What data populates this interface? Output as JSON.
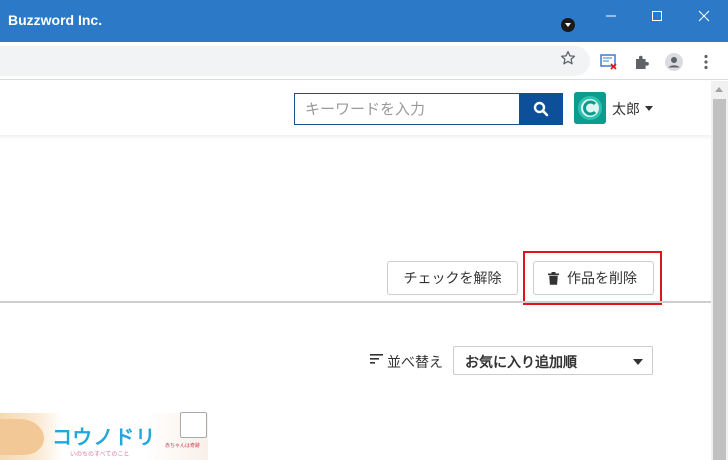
{
  "window": {
    "title": "Buzzword Inc."
  },
  "header": {
    "search": {
      "placeholder": "キーワードを入力"
    },
    "user": {
      "name": "太郎"
    }
  },
  "actions": {
    "uncheck_label": "チェックを解除",
    "delete_label": "作品を削除"
  },
  "sort": {
    "label": "並べ替え",
    "selected": "お気に入り追加順"
  },
  "card": {
    "logo": "コウノドリ",
    "sub": "いのちのすべてのこと",
    "note": "赤ちゃんは奇跡"
  },
  "colors": {
    "titlebar": "#2b79c7",
    "search_button": "#0d4f99",
    "highlight": "#e0141b"
  }
}
